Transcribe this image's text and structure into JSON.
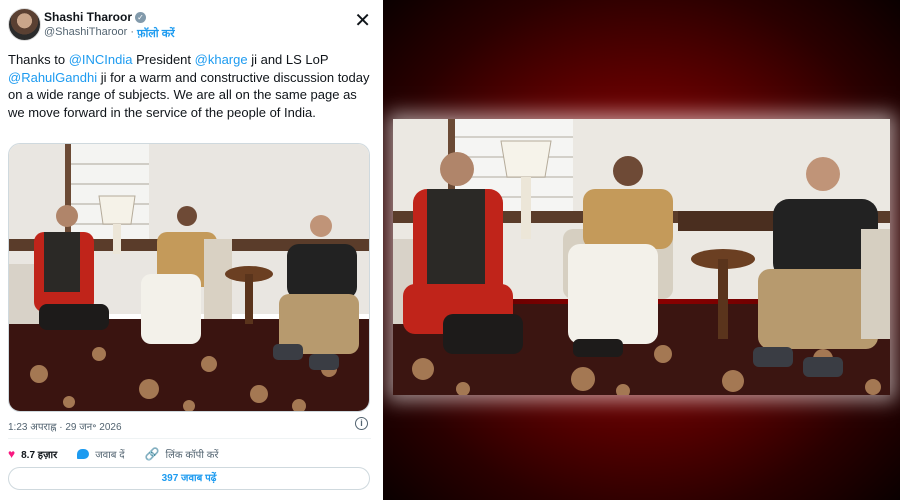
{
  "tweet": {
    "author_name": "Shashi Tharoor",
    "handle": "@ShashiTharoor",
    "separator": "·",
    "follow_label": "फ़ॉलो करें",
    "close_icon": "close-x-icon",
    "text": {
      "p1": "Thanks to ",
      "m1": "@INCIndia",
      "p2": " President ",
      "m2": "@kharge",
      "p3": " ji and LS LoP ",
      "m3": "@RahulGandhi",
      "p4": " ji for a warm and constructive discussion today on a wide range of subjects. We are all on the same page as we move forward in the service of the people of India."
    },
    "timestamp": "1:23 अपराह्न · 29 जन॰ 2026",
    "likes_count": "8.7 हज़ार",
    "reply_label": "जवाब दें",
    "copy_link_label": "लिंक कॉपी करें",
    "read_replies_label": "397 जवाब पढ़ें"
  },
  "colors": {
    "link_blue": "#1d9bf0",
    "like_pink": "#f91880",
    "panel_red": "#9c0000"
  }
}
